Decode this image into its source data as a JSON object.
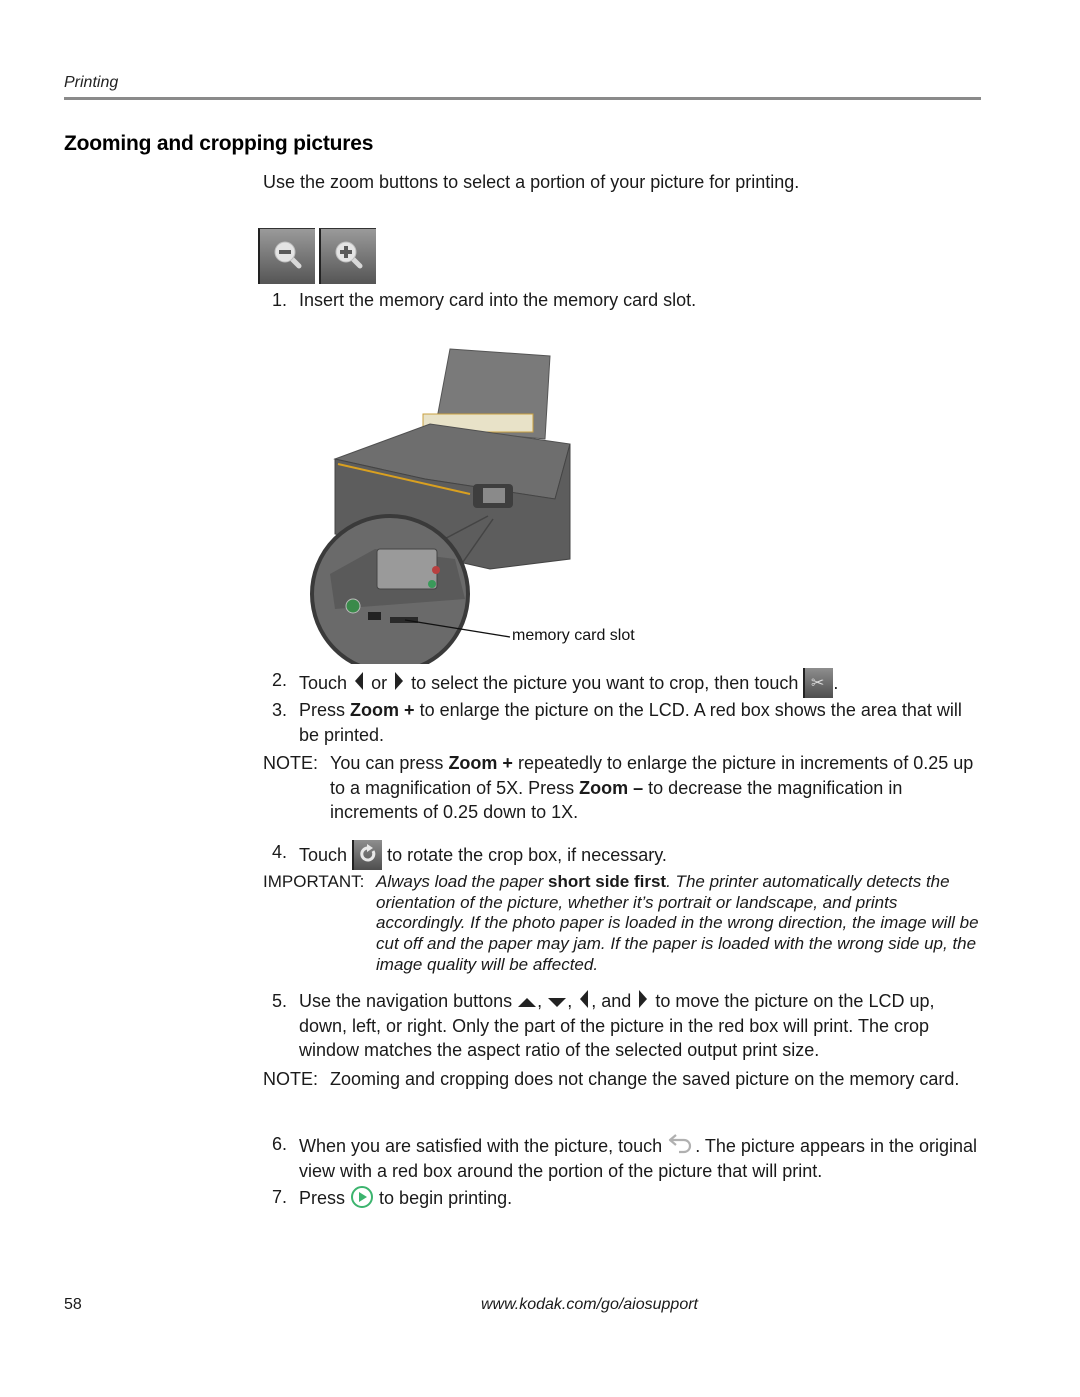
{
  "header": {
    "section": "Printing"
  },
  "title": "Zooming and cropping pictures",
  "intro": "Use the zoom buttons to select a portion of your picture for printing.",
  "zoom_buttons": [
    {
      "name": "zoom-out",
      "icon": "magnifier-minus-icon"
    },
    {
      "name": "zoom-in",
      "icon": "magnifier-plus-icon"
    }
  ],
  "steps": {
    "s1": {
      "num": "1.",
      "text": "Insert the memory card into the memory card slot."
    },
    "s2": {
      "num": "2.",
      "a": "Touch",
      "b": "or",
      "c": "to select the picture you want to crop, then touch",
      "d": "."
    },
    "s3": {
      "num": "3.",
      "a": "Press",
      "bold": "Zoom +",
      "c": "to enlarge the picture on the LCD. A red box shows the area that will be printed."
    },
    "s4": {
      "num": "4.",
      "a": "Touch",
      "c": "to rotate the crop box, if necessary."
    },
    "s5": {
      "num": "5.",
      "a": "Use the navigation buttons",
      "sep1": ",",
      "sep2": ",",
      "sep3": ", and",
      "c": "to move the picture on the LCD up, down, left, or right. Only the part of the picture in the red box will print. The crop window matches the aspect ratio of the selected output print size."
    },
    "s6": {
      "num": "6.",
      "a": "When you are satisfied with the picture, touch",
      "c": ". The picture appears in the original view with a red box around the portion of the picture that will print."
    },
    "s7": {
      "num": "7.",
      "a": "Press",
      "c": "to begin printing."
    }
  },
  "figure": {
    "callout": "memory card slot"
  },
  "note1": {
    "label": "NOTE:",
    "a": "You can press",
    "b1": "Zoom +",
    "c": "repeatedly to enlarge the picture in increments of 0.25 up to a magnification of 5X. Press",
    "b2": "Zoom –",
    "d": "to decrease the magnification in increments of 0.25 down to 1X."
  },
  "important": {
    "label": "IMPORTANT:",
    "a": "Always load the paper",
    "bold": "short side first",
    "c": ". The printer automatically detects the orientation of the picture, whether it’s portrait or landscape, and prints accordingly. If the photo paper is loaded in the wrong direction, the image will be cut off and the paper may jam. If the paper is loaded with the wrong side up, the image quality will be affected."
  },
  "note2": {
    "label": "NOTE:",
    "text": "Zooming and cropping does not change the saved picture on the memory card."
  },
  "footer": {
    "page": "58",
    "url": "www.kodak.com/go/aiosupport"
  },
  "colors": {
    "rule": "#8a8a8a",
    "accent_green": "#3cb46e",
    "printer_body": "#6b6b6b",
    "trim": "#d9a020"
  }
}
